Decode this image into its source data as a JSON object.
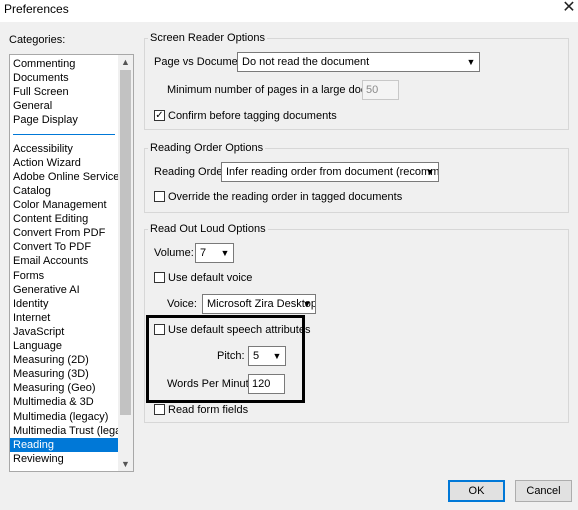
{
  "window": {
    "title": "Preferences",
    "close_glyph": "✕"
  },
  "categories": {
    "label": "Categories:",
    "group1": [
      "Commenting",
      "Documents",
      "Full Screen",
      "General",
      "Page Display"
    ],
    "group2": [
      "Accessibility",
      "Action Wizard",
      "Adobe Online Services",
      "Catalog",
      "Color Management",
      "Content Editing",
      "Convert From PDF",
      "Convert To PDF",
      "Email Accounts",
      "Forms",
      "Generative AI",
      "Identity",
      "Internet",
      "JavaScript",
      "Language",
      "Measuring (2D)",
      "Measuring (3D)",
      "Measuring (Geo)",
      "Multimedia & 3D",
      "Multimedia (legacy)",
      "Multimedia Trust (legacy)",
      "Reading",
      "Reviewing"
    ],
    "selected": "Reading"
  },
  "screen_reader": {
    "title": "Screen Reader Options",
    "page_vs_doc_label": "Page vs Document:",
    "page_vs_doc_value": "Do not read the document",
    "min_pages_label": "Minimum number of pages in a large document:",
    "min_pages_value": "50",
    "confirm_label": "Confirm before tagging documents",
    "confirm_checked": true
  },
  "reading_order": {
    "title": "Reading Order Options",
    "order_label": "Reading Order:",
    "order_value": "Infer reading order from document (recommended)",
    "override_label": "Override the reading order in tagged documents",
    "override_checked": false
  },
  "read_out_loud": {
    "title": "Read Out Loud Options",
    "volume_label": "Volume:",
    "volume_value": "7",
    "default_voice_label": "Use default voice",
    "default_voice_checked": false,
    "voice_label": "Voice:",
    "voice_value": "Microsoft Zira Desktop -",
    "default_speech_label": "Use default speech attributes",
    "default_speech_checked": false,
    "pitch_label": "Pitch:",
    "pitch_value": "5",
    "wpm_label": "Words Per Minute:",
    "wpm_value": "120",
    "form_fields_label": "Read form fields",
    "form_fields_checked": false
  },
  "buttons": {
    "ok": "OK",
    "cancel": "Cancel"
  }
}
